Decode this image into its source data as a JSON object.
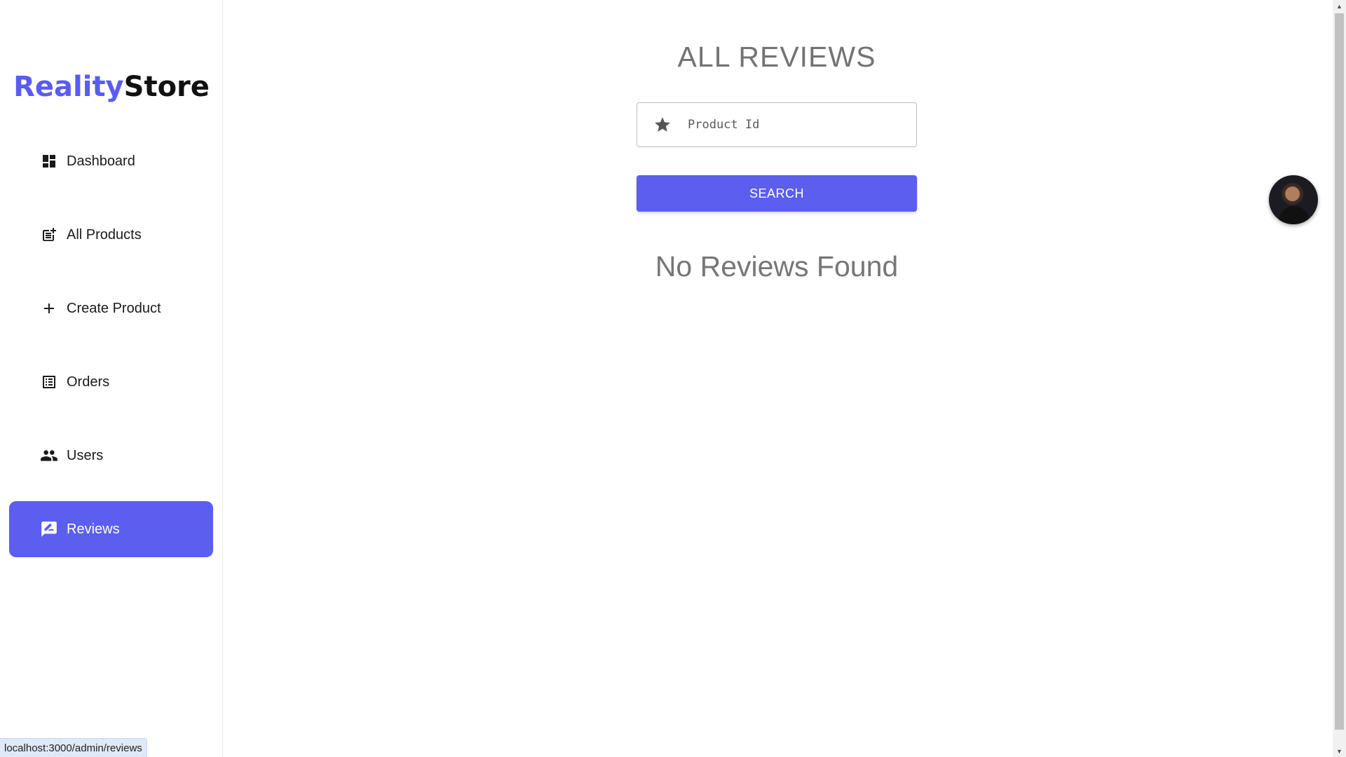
{
  "brand": {
    "part1": "Reality",
    "part2": "Store",
    "color_primary": "#5a5cf0"
  },
  "sidebar": {
    "items": [
      {
        "label": "Dashboard",
        "icon": "dashboard-icon"
      },
      {
        "label": "All Products",
        "icon": "post-add-icon"
      },
      {
        "label": "Create Product",
        "icon": "add-icon"
      },
      {
        "label": "Orders",
        "icon": "list-alt-icon"
      },
      {
        "label": "Users",
        "icon": "people-icon"
      },
      {
        "label": "Reviews",
        "icon": "rate-review-icon",
        "active": true
      }
    ]
  },
  "main": {
    "title": "ALL REVIEWS",
    "search": {
      "placeholder": "Product Id",
      "value": "",
      "icon": "star-icon"
    },
    "search_button": "SEARCH",
    "empty_message": "No Reviews Found"
  },
  "status_bar": {
    "url": "localhost:3000/admin/reviews"
  },
  "colors": {
    "accent": "#5b5eef",
    "text_muted": "#737373"
  }
}
